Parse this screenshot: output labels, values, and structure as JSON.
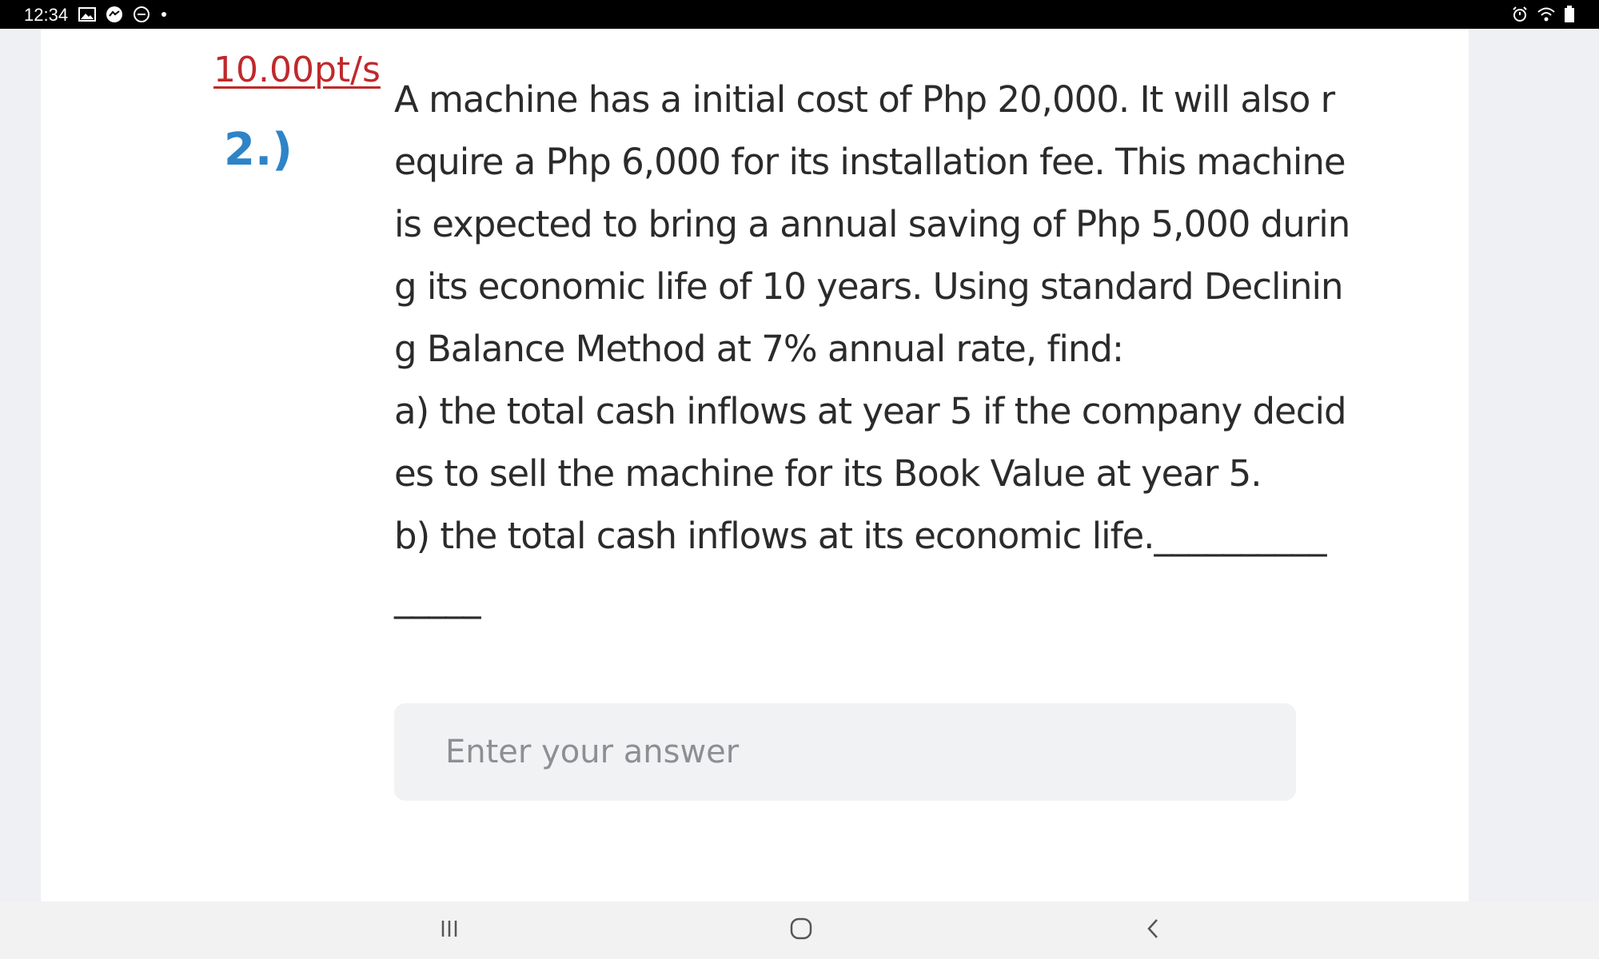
{
  "status_bar": {
    "time": "12:34",
    "left_icons": [
      "gallery-icon",
      "messenger-icon",
      "dnd-icon",
      "dot-icon"
    ],
    "right_icons": [
      "alarm-icon",
      "wifi-icon",
      "battery-icon"
    ]
  },
  "question": {
    "points": "10.00pt/s",
    "number": "2.)",
    "lines": [
      "A machine has a initial cost  of Php 20,000. It will also r",
      "equire a Php 6,000 for its installation fee. This machine",
      "is expected to bring a annual saving of Php 5,000 durin",
      "g its economic life of 10 years. Using standard Declinin",
      "g Balance Method at 7% annual rate, find:",
      "a) the total cash inflows at year 5 if the company decid",
      "es to sell the machine for its Book Value at year 5.",
      "b) the total cash inflows at its economic life.__________",
      "_____"
    ]
  },
  "answer": {
    "value": "",
    "placeholder": "Enter your answer"
  },
  "nav_bar": {
    "buttons": [
      "recent-apps-icon",
      "home-icon",
      "back-icon"
    ]
  }
}
